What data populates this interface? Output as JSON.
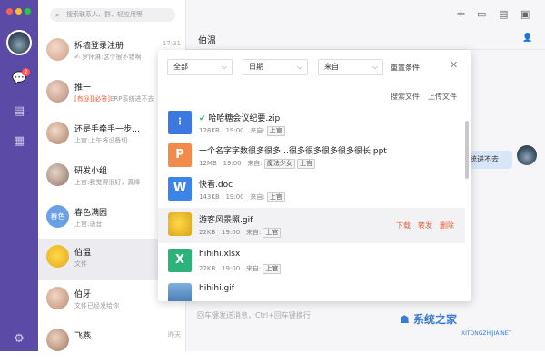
{
  "search": {
    "placeholder": "搜索联系人、群、轻应用等"
  },
  "badge": "2",
  "contacts": [
    {
      "name": "拆墙登录注册",
      "msg": "✍ 罗怀淋:这个很不错啊",
      "time": "17:31"
    },
    {
      "name": "推一",
      "msg_prefix": "[有@][必答]",
      "msg": "ERP系统进不去",
      "time": ""
    },
    {
      "name": "还是手牵手一步…",
      "msg": "上官:上午将设备切",
      "time": ""
    },
    {
      "name": "研发小组",
      "msg": "上官:我觉得很好，真棒~",
      "time": ""
    },
    {
      "name": "春色满园",
      "avatar_text": "春色",
      "msg": "上官:语音",
      "time": ""
    },
    {
      "name": "伯温",
      "msg": "文件",
      "time": ""
    },
    {
      "name": "伯牙",
      "msg": "文件已经发给你",
      "time": ""
    },
    {
      "name": "飞燕",
      "msg": "",
      "time": "昨天"
    }
  ],
  "chat": {
    "title": "伯温",
    "bubble": "统进不去",
    "input_line": "㊣ 以之   测  文件",
    "input_hint": "回车键发送消息，Ctrl+回车键换行"
  },
  "filters": {
    "type": "全部",
    "date": "日期",
    "from": "来自",
    "reset": "重置条件"
  },
  "actions": {
    "search_file": "搜索文件",
    "upload_file": "上传文件"
  },
  "files": [
    {
      "name": "哈哈糖会议纪要.zip",
      "size": "128KB",
      "time": "19:00",
      "from_label": "来自:",
      "from": "上官",
      "icon_color": "#3d78e0",
      "icon": "zip-icon",
      "verified": true
    },
    {
      "name": "一个名字字数很多很多…很多很多很多很多很长.ppt",
      "size": "12MB",
      "time": "19:00",
      "from_label": "来自:",
      "from": "魔法少女",
      "from2": "上官",
      "icon_color": "#f28a4a",
      "icon": "ppt-icon",
      "glyph": "P"
    },
    {
      "name": "快看.doc",
      "size": "143KB",
      "time": "19:00",
      "from_label": "来自:",
      "from": "上官",
      "icon_color": "#3d84e8",
      "icon": "doc-icon",
      "glyph": "W"
    },
    {
      "name": "游客风景照.gif",
      "size": "22KB",
      "time": "19:00",
      "from_label": "来自:",
      "from": "上官",
      "icon_color": "#e8c33a",
      "icon": "gif-image-icon",
      "actions": [
        "下载",
        "转发",
        "删除"
      ]
    },
    {
      "name": "hihihi.xlsx",
      "size": "22KB",
      "time": "19:00",
      "from_label": "来自:",
      "from": "上官",
      "icon_color": "#2db37a",
      "icon": "xlsx-icon",
      "glyph": "X"
    },
    {
      "name": "hihihi.gif",
      "size": "",
      "time": "",
      "from_label": "",
      "from": "",
      "icon_color": "#5a8fc8",
      "icon": "gif-image-icon"
    }
  ],
  "watermark": {
    "text": "系统之家",
    "url": "XITONGZHIJIA.NET"
  }
}
